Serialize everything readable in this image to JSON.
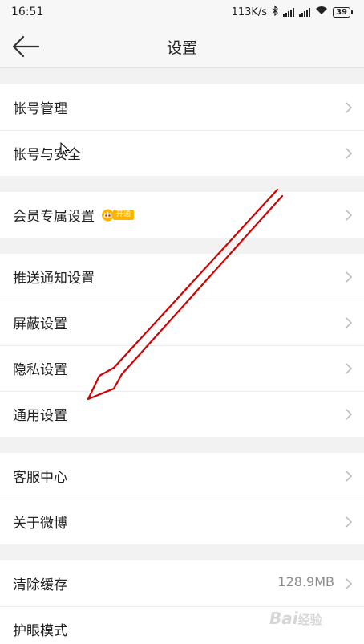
{
  "status_bar": {
    "time": "16:51",
    "speed": "113K/s",
    "battery": "39"
  },
  "header": {
    "title": "设置",
    "back_icon": "arrow-left-icon"
  },
  "groups": [
    {
      "items": [
        {
          "label": "帐号管理"
        },
        {
          "label": "帐号与安全"
        }
      ]
    },
    {
      "items": [
        {
          "label": "会员专属设置",
          "badge": "开通"
        }
      ]
    },
    {
      "items": [
        {
          "label": "推送通知设置"
        },
        {
          "label": "屏蔽设置"
        },
        {
          "label": "隐私设置"
        },
        {
          "label": "通用设置"
        }
      ]
    },
    {
      "items": [
        {
          "label": "客服中心"
        },
        {
          "label": "关于微博"
        }
      ]
    },
    {
      "items": [
        {
          "label": "清除缓存",
          "value": "128.9MB"
        },
        {
          "label": "护眼模式"
        }
      ]
    }
  ],
  "annotation": {
    "color": "#d40000",
    "icon": "red-arrow-annotation"
  },
  "watermark": {
    "brand": "Bai",
    "brand_tail": "经验"
  }
}
